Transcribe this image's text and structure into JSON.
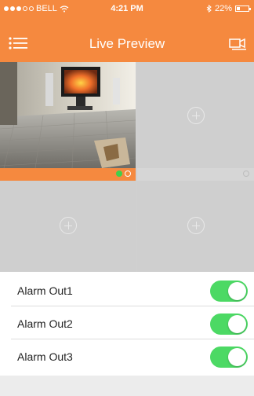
{
  "status_bar": {
    "carrier": "BELL",
    "time": "4:21 PM",
    "battery": "22%"
  },
  "nav": {
    "title": "Live Preview",
    "left_icon": "menu-icon",
    "right_icon": "camera-icon"
  },
  "grid": {
    "cells": [
      {
        "state": "preview"
      },
      {
        "state": "empty"
      },
      {
        "state": "empty"
      },
      {
        "state": "empty"
      }
    ],
    "add_icon": "plus-circle-icon",
    "status_color": "#3fcf4b"
  },
  "alarms": [
    {
      "label": "Alarm Out1",
      "on": true
    },
    {
      "label": "Alarm Out2",
      "on": true
    },
    {
      "label": "Alarm Out3",
      "on": true
    }
  ],
  "colors": {
    "accent": "#f5893f",
    "toggle_on": "#4cd964",
    "background": "#ececec"
  }
}
